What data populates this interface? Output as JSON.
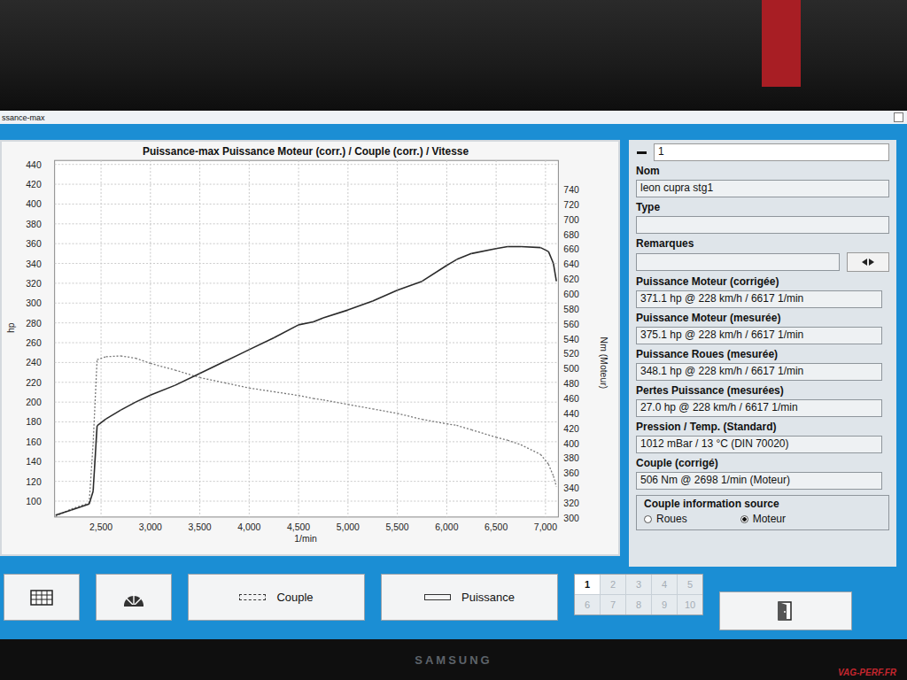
{
  "window": {
    "title": "ssance-max"
  },
  "chart": {
    "title": "Puissance-max Puissance Moteur (corr.) / Couple (corr.) / Vitesse",
    "x_axis": {
      "label": "1/min",
      "ticks": [
        "2,500",
        "3,000",
        "3,500",
        "4,000",
        "4,500",
        "5,000",
        "5,500",
        "6,000",
        "6,500",
        "7,000"
      ]
    },
    "left_axis": {
      "label": "hp",
      "ticks": [
        "100",
        "120",
        "140",
        "160",
        "180",
        "200",
        "220",
        "240",
        "260",
        "280",
        "300",
        "320",
        "340",
        "360",
        "380",
        "400",
        "420",
        "440"
      ]
    },
    "right_axis": {
      "label": "Nm (Moteur)",
      "ticks": [
        "300",
        "320",
        "340",
        "360",
        "380",
        "400",
        "420",
        "440",
        "460",
        "480",
        "500",
        "520",
        "540",
        "560",
        "580",
        "600",
        "620",
        "640",
        "660",
        "680",
        "700",
        "720",
        "740"
      ]
    },
    "rpm": [
      2040,
      2200,
      2380,
      2420,
      2460,
      2550,
      2700,
      2850,
      3000,
      3250,
      3500,
      3750,
      4000,
      4250,
      4500,
      4650,
      4750,
      5000,
      5250,
      5500,
      5750,
      6000,
      6100,
      6250,
      6500,
      6617,
      6750,
      6950,
      7030,
      7080,
      7110
    ],
    "series": [
      {
        "name": "Couple",
        "axis": "right",
        "kind": "dotted",
        "values": [
          302,
          312,
          320,
          400,
          512,
          516,
          517,
          514,
          507,
          498,
          488,
          481,
          474,
          469,
          464,
          460,
          458,
          452,
          446,
          440,
          432,
          426,
          424,
          418,
          408,
          404,
          398,
          385,
          372,
          356,
          342
        ]
      },
      {
        "name": "Puissance",
        "axis": "left",
        "kind": "solid",
        "values": [
          86,
          91,
          97,
          110,
          176,
          183,
          192,
          200,
          207,
          217,
          229,
          241,
          253,
          265,
          278,
          281,
          285,
          293,
          302,
          313,
          322,
          338,
          344,
          350,
          355,
          357,
          357,
          356,
          352,
          340,
          322
        ]
      }
    ]
  },
  "panel": {
    "header_value": "1",
    "fields": [
      {
        "label": "Nom",
        "value": "leon cupra stg1"
      },
      {
        "label": "Type",
        "value": ""
      },
      {
        "label": "Remarques",
        "value": ""
      }
    ],
    "results": [
      {
        "label": "Puissance Moteur (corrigée)",
        "value": "371.1 hp @ 228 km/h / 6617 1/min"
      },
      {
        "label": "Puissance Moteur (mesurée)",
        "value": "375.1 hp @ 228 km/h / 6617 1/min"
      },
      {
        "label": "Puissance Roues (mesurée)",
        "value": "348.1 hp @ 228 km/h / 6617 1/min"
      },
      {
        "label": "Pertes Puissance (mesurées)",
        "value": "27.0 hp @ 228 km/h / 6617 1/min"
      },
      {
        "label": "Pression / Temp. (Standard)",
        "value": "1012 mBar / 13 °C (DIN 70020)"
      },
      {
        "label": "Couple (corrigé)",
        "value": "506 Nm @ 2698 1/min (Moteur)"
      }
    ],
    "source_group": {
      "title": "Couple information source",
      "options": [
        {
          "label": "Roues",
          "selected": false
        },
        {
          "label": "Moteur",
          "selected": true
        }
      ]
    }
  },
  "pages": [
    {
      "label": "1",
      "selected": true,
      "disabled": false
    },
    {
      "label": "2",
      "selected": false,
      "disabled": true
    },
    {
      "label": "3",
      "selected": false,
      "disabled": true
    },
    {
      "label": "4",
      "selected": false,
      "disabled": true
    },
    {
      "label": "5",
      "selected": false,
      "disabled": true
    },
    {
      "label": "6",
      "selected": false,
      "disabled": true
    },
    {
      "label": "7",
      "selected": false,
      "disabled": true
    },
    {
      "label": "8",
      "selected": false,
      "disabled": true
    },
    {
      "label": "9",
      "selected": false,
      "disabled": true
    },
    {
      "label": "10",
      "selected": false,
      "disabled": true
    }
  ],
  "bezel": {
    "brand": "SAMSUNG",
    "watermark": "VAG-PERF.FR"
  }
}
